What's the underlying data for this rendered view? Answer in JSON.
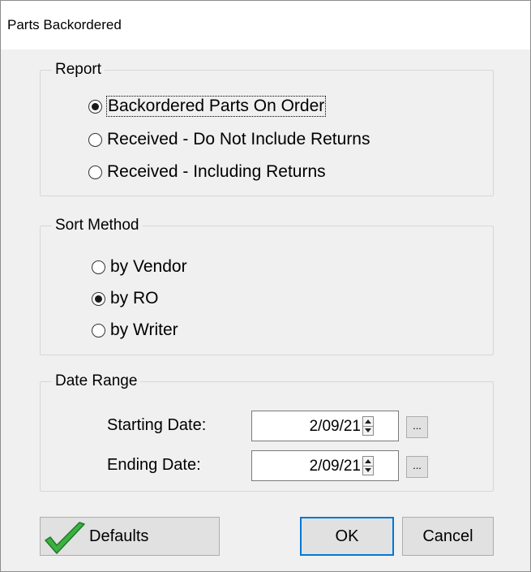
{
  "window": {
    "title": "Parts Backordered"
  },
  "report": {
    "legend": "Report",
    "options": [
      {
        "label": "Backordered Parts On Order",
        "selected": true
      },
      {
        "label": "Received - Do Not Include Returns",
        "selected": false
      },
      {
        "label": "Received - Including Returns",
        "selected": false
      }
    ]
  },
  "sort": {
    "legend": "Sort Method",
    "options": [
      {
        "label": "by Vendor",
        "selected": false
      },
      {
        "label": "by RO",
        "selected": true
      },
      {
        "label": "by Writer",
        "selected": false
      }
    ]
  },
  "date_range": {
    "legend": "Date Range",
    "starting_label": "Starting Date:",
    "starting_value": "2/09/21",
    "ending_label": "Ending Date:",
    "ending_value": "2/09/21",
    "browse_label": "..."
  },
  "buttons": {
    "defaults": "Defaults",
    "ok": "OK",
    "cancel": "Cancel"
  },
  "colors": {
    "focus_border": "#0078d7",
    "check_green": "#3cb043"
  }
}
